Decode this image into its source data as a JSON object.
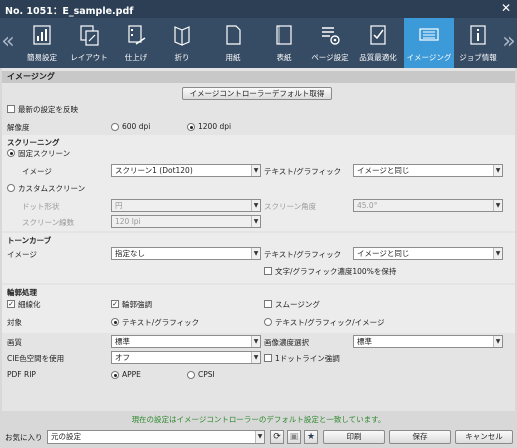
{
  "window": {
    "title": "No. 1051：E_sample.pdf",
    "close": "✕"
  },
  "toolbar": {
    "prev": "«",
    "next": "»",
    "tabs": [
      {
        "label": "簡易設定",
        "icon": "bar-chart-icon"
      },
      {
        "label": "レイアウト",
        "icon": "layout-icon"
      },
      {
        "label": "仕上げ",
        "icon": "finishing-icon"
      },
      {
        "label": "折り",
        "icon": "fold-icon"
      },
      {
        "label": "用紙",
        "icon": "paper-icon"
      },
      {
        "label": "表紙",
        "icon": "cover-icon"
      },
      {
        "label": "ページ設定",
        "icon": "page-settings-icon"
      },
      {
        "label": "品質最適化",
        "icon": "quality-icon"
      },
      {
        "label": "イメージング",
        "icon": "imaging-icon"
      },
      {
        "label": "ジョブ情報",
        "icon": "info-icon"
      }
    ],
    "active_tab": "イメージング"
  },
  "imaging": {
    "section_title": "イメージング",
    "default_button": "イメージコントローラーデフォルト取得",
    "reflect_latest": "最新の設定を反映",
    "resolution_label": "解像度",
    "res_600": "600 dpi",
    "res_1200": "1200 dpi",
    "resolution_value": "1200 dpi"
  },
  "screening": {
    "title": "スクリーニング",
    "fixed": "固定スクリーン",
    "image_label": "イメージ",
    "image_value": "スクリーン1 (Dot120)",
    "text_label": "テキスト/グラフィック",
    "text_value": "イメージと同じ",
    "custom": "カスタムスクリーン",
    "dot_label": "ドット形状",
    "dot_value": "円",
    "angle_label": "スクリーン角度",
    "angle_value": "45.0°",
    "lines_label": "スクリーン線数",
    "lines_value": "120 lpi"
  },
  "tone": {
    "title": "トーンカーブ",
    "image_label": "イメージ",
    "image_value": "指定なし",
    "text_label": "テキスト/グラフィック",
    "text_value": "イメージと同じ",
    "keep100": "文字/グラフィック濃度100%を保持"
  },
  "edge": {
    "title": "輪郭処理",
    "thin": "細線化",
    "enhance": "輪郭強調",
    "smoothing": "スムージング",
    "target_label": "対象",
    "target_text": "テキスト/グラフィック",
    "target_text_image": "テキスト/グラフィック/イメージ"
  },
  "quality": {
    "label": "画質",
    "value": "標準",
    "density_label": "画像濃度選択",
    "density_value": "標準",
    "cie_label": "CIE色空間を使用",
    "cie_value": "オフ",
    "dotline": "1ドットライン強調",
    "pdfrip_label": "PDF RIP",
    "appe": "APPE",
    "cpsi": "CPSI"
  },
  "status": "現在の設定はイメージコントローラーのデフォルト設定と一致しています。",
  "footer": {
    "favorites_label": "お気に入り",
    "favorites_value": "元の設定",
    "refresh": "⟳",
    "save_icon": "▣",
    "star": "★",
    "print": "印刷",
    "save": "保存",
    "cancel": "キャンセル"
  },
  "colors": {
    "titlebar": "#2c3f55",
    "toolbar": "#364b64",
    "active_tab": "#3c9ad8",
    "status_text": "#2e8a2e"
  }
}
